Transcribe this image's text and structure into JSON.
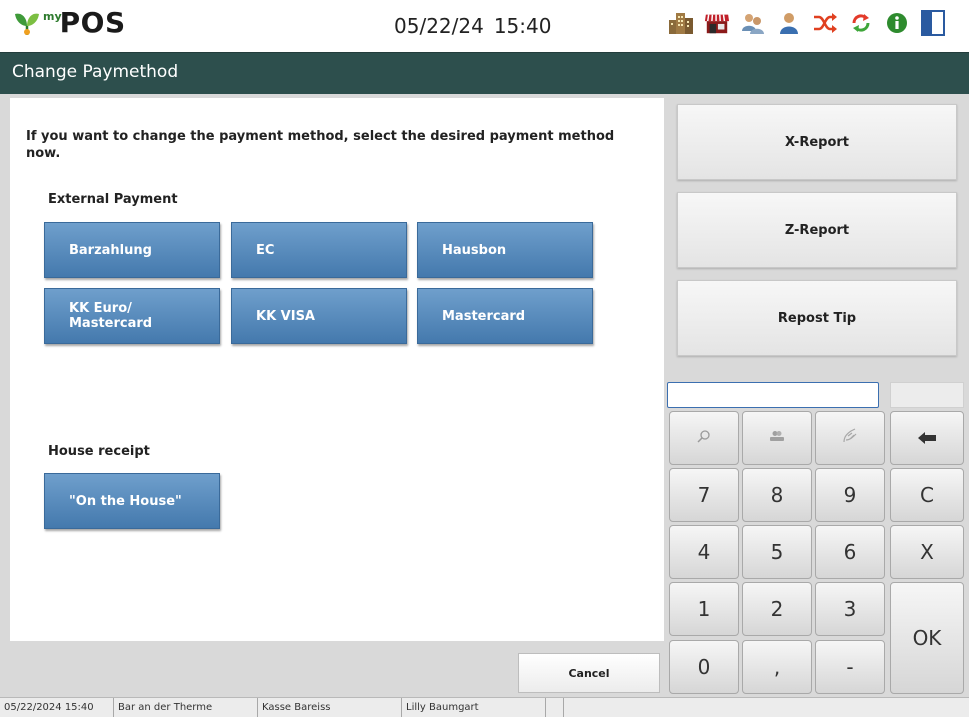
{
  "app": {
    "logo_sup": "my",
    "logo_text": "POS"
  },
  "clock": {
    "date": "05/22/24",
    "time": "15:40"
  },
  "header_icons": [
    "building-icon",
    "shop-icon",
    "users-icon",
    "user-icon",
    "shuffle-icon",
    "refresh-icon",
    "info-icon",
    "panel-icon"
  ],
  "title": "Change Paymethod",
  "instruction": "If you want to change the payment method, select the desired payment method now.",
  "external_payment": {
    "label": "External Payment",
    "buttons": [
      "Barzahlung",
      "EC",
      "Hausbon",
      "KK Euro/ Mastercard",
      "KK VISA",
      "Mastercard"
    ]
  },
  "house_receipt": {
    "label": "House receipt",
    "buttons": [
      "\"On the House\""
    ]
  },
  "cancel_label": "Cancel",
  "reports": [
    "X-Report",
    "Z-Report",
    "Repost Tip"
  ],
  "keypad": {
    "input_value": "",
    "icons": [
      "search-icon",
      "customer-icon",
      "tip-hand-icon",
      "backspace-icon"
    ],
    "keys": [
      "7",
      "8",
      "9",
      "C",
      "4",
      "5",
      "6",
      "X",
      "1",
      "2",
      "3",
      "OK",
      "0",
      ",",
      "-"
    ]
  },
  "status": [
    "05/22/2024 15:40",
    "Bar an der Therme",
    "Kasse Bareiss",
    "Lilly Baumgart",
    "",
    ""
  ],
  "colors": {
    "title_bg": "#2d4f4d",
    "payment_button": "#5a8bbd",
    "accent_green": "#2d7a2d"
  }
}
